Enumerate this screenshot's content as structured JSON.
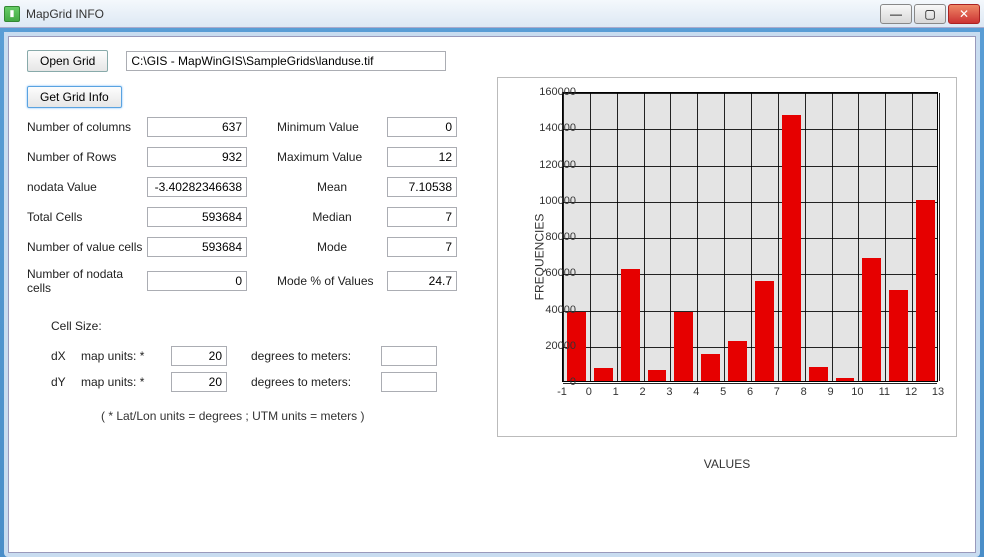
{
  "window": {
    "title": "MapGrid INFO"
  },
  "buttons": {
    "open_grid": "Open Grid",
    "get_info": "Get Grid Info"
  },
  "path_field": {
    "value": "C:\\GIS - MapWinGIS\\SampleGrids\\landuse.tif"
  },
  "stats": {
    "cols_label": "Number of columns",
    "cols_value": "637",
    "rows_label": "Number of  Rows",
    "rows_value": "932",
    "nodata_label": "nodata Value",
    "nodata_value": "-3.40282346638",
    "total_label": "Total Cells",
    "total_value": "593684",
    "valuecells_label": "Number of  value cells",
    "valuecells_value": "593684",
    "nodatacells_label": "Number of  nodata cells",
    "nodatacells_value": "0",
    "min_label": "Minimum Value",
    "min_value": "0",
    "max_label": "Maximum Value",
    "max_value": "12",
    "mean_label": "Mean",
    "mean_value": "7.10538",
    "median_label": "Median",
    "median_value": "7",
    "mode_label": "Mode",
    "mode_value": "7",
    "modepct_label": "Mode % of Values",
    "modepct_value": "24.7"
  },
  "cellsize": {
    "title": "Cell Size:",
    "dx_label": "dX",
    "dy_label": "dY",
    "units_label": "map units: *",
    "dx_value": "20",
    "dy_value": "20",
    "deg2m_label": "degrees to meters:",
    "dx_deg2m": "",
    "dy_deg2m": "",
    "note": "( * Lat/Lon units = degrees ;   UTM units = meters )"
  },
  "chart_data": {
    "type": "bar",
    "categories": [
      0,
      1,
      2,
      3,
      4,
      5,
      6,
      7,
      8,
      9,
      10,
      11,
      12
    ],
    "values": [
      38000,
      7000,
      62000,
      6000,
      38000,
      15000,
      22000,
      55000,
      147000,
      7500,
      1500,
      68000,
      50000,
      100000
    ],
    "title": "",
    "xlabel": "VALUES",
    "ylabel": "FREQUENCIES",
    "xlim": [
      -1,
      13
    ],
    "ylim": [
      0,
      160000
    ],
    "y_ticks": [
      0,
      20000,
      40000,
      60000,
      80000,
      100000,
      120000,
      140000,
      160000
    ],
    "x_ticks": [
      -1,
      0,
      1,
      2,
      3,
      4,
      5,
      6,
      7,
      8,
      9,
      10,
      11,
      12,
      13
    ]
  }
}
